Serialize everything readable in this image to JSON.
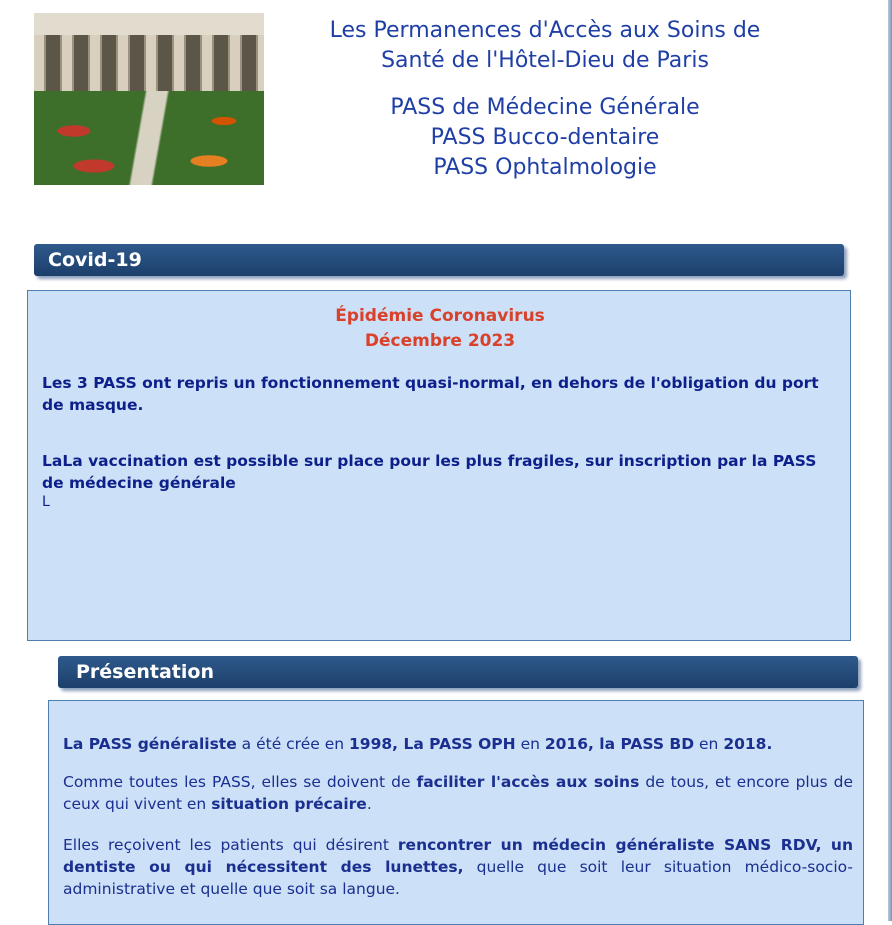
{
  "header": {
    "title_line1": "Les Permanences d'Accès aux Soins de",
    "title_line2": "Santé de l'Hôtel-Dieu de Paris",
    "pass_items": [
      "PASS de Médecine Générale",
      "PASS Bucco-dentaire",
      "PASS Ophtalmologie"
    ]
  },
  "covid": {
    "section_title": "Covid-19",
    "headline1": "Épidémie Coronavirus",
    "headline2": "Décembre 2023",
    "para1": "Les 3 PASS ont repris un fonctionnement quasi-normal, en dehors de l'obligation du port de masque.",
    "para2": "LaLa vaccination est possible sur place pour les plus fragiles, sur inscription par la PASS de médecine générale",
    "stray": "L"
  },
  "presentation": {
    "section_title": "Présentation",
    "p1": {
      "s1": "La PASS généraliste",
      "s2": " a été crée en ",
      "s3": "1998, La PASS OPH",
      "s4": " en ",
      "s5": "2016, la PASS BD",
      "s6": " en ",
      "s7": "2018."
    },
    "p2": {
      "s1": "Comme toutes les PASS, elles se doivent de ",
      "s2": "faciliter l'accès aux soins",
      "s3": " de tous, et encore plus de ceux qui vivent en ",
      "s4": "situation précaire",
      "s5": "."
    },
    "p3": {
      "s1": "Elles reçoivent les patients qui désirent ",
      "s2": "rencontrer un médecin généraliste SANS RDV, un dentiste ou qui nécessitent des lunettes,",
      "s3": " quelle que soit leur situation médico-socio-administrative et quelle que soit sa langue."
    }
  },
  "colors": {
    "bar": "#1c3f6b",
    "panel": "#cce0f7",
    "headline": "#d9412a",
    "text": "#0c1f8a"
  }
}
